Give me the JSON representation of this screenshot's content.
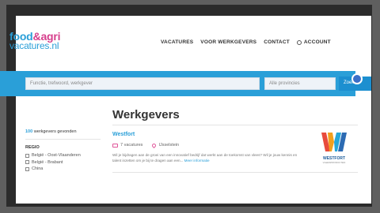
{
  "logo": {
    "line1_a": "food",
    "line1_b": "&",
    "line1_c": "agri",
    "line2": "vacatures.nl"
  },
  "nav": {
    "items": [
      "VACATURES",
      "VOOR WERKGEVERS",
      "CONTACT"
    ],
    "account": "ACCOUNT"
  },
  "search": {
    "keyword_placeholder": "Functie, trefwoord, werkgever",
    "location_placeholder": "Alle provincies",
    "button": "Zoek"
  },
  "main": {
    "title": "Werkgevers"
  },
  "sidebar": {
    "count_bold": "100",
    "count_text": " werkgevers gevonden",
    "filter_title": "REGIO",
    "options": [
      "Belgiё - Oost-Vlaanderen",
      "Belgiё - Brabant",
      "China"
    ]
  },
  "company": {
    "name": "Westfort",
    "vacancies": "7 vacatures",
    "location": "IJsselstein",
    "description": "Wil je bijdragen aan de groei van een innovatief bedrijf dat werkt aan de toekomst van vlees? Wil je jouw kennis en talent inzetten om je bij te dragen aan een...",
    "more": "Meer informatie",
    "logo_text": "WESTFORT",
    "logo_sub": "VLEESPRODUCTEN"
  },
  "colors": {
    "brand_blue": "#2a9fd8",
    "brand_pink": "#d63f8c"
  }
}
